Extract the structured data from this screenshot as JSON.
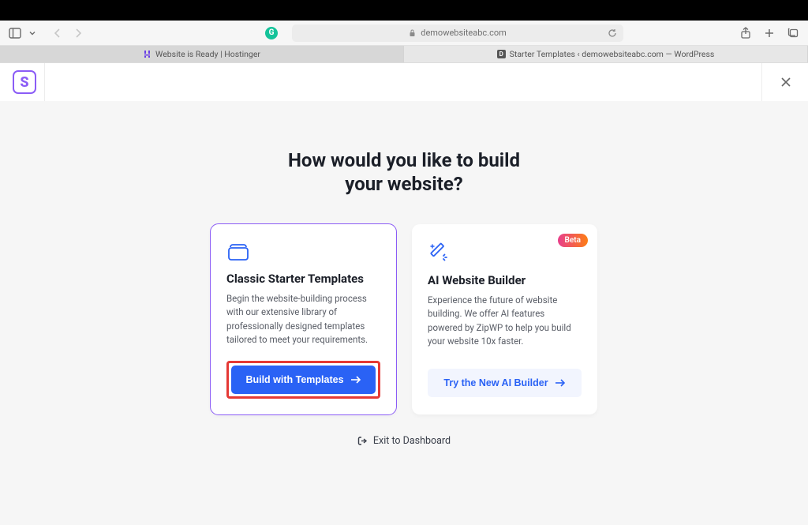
{
  "browser": {
    "address": "demowebsiteabc.com",
    "tabs": [
      {
        "label": "Website is Ready | Hostinger",
        "favicon": "h-letter"
      },
      {
        "label": "Starter Templates ‹ demowebsiteabc.com — WordPress",
        "favicon": "d-letter"
      }
    ]
  },
  "app": {
    "logo_letter": "S",
    "heading_line1": "How would you like to build",
    "heading_line2": "your website?",
    "cards": {
      "classic": {
        "title": "Classic Starter Templates",
        "desc": "Begin the website-building process with our extensive library of professionally designed templates tailored to meet your requirements.",
        "cta": "Build with Templates"
      },
      "ai": {
        "badge": "Beta",
        "title": "AI Website Builder",
        "desc": "Experience the future of website building. We offer AI features powered by ZipWP to help you build your website 10x faster.",
        "cta": "Try the New AI Builder"
      }
    },
    "exit_label": "Exit to Dashboard"
  }
}
